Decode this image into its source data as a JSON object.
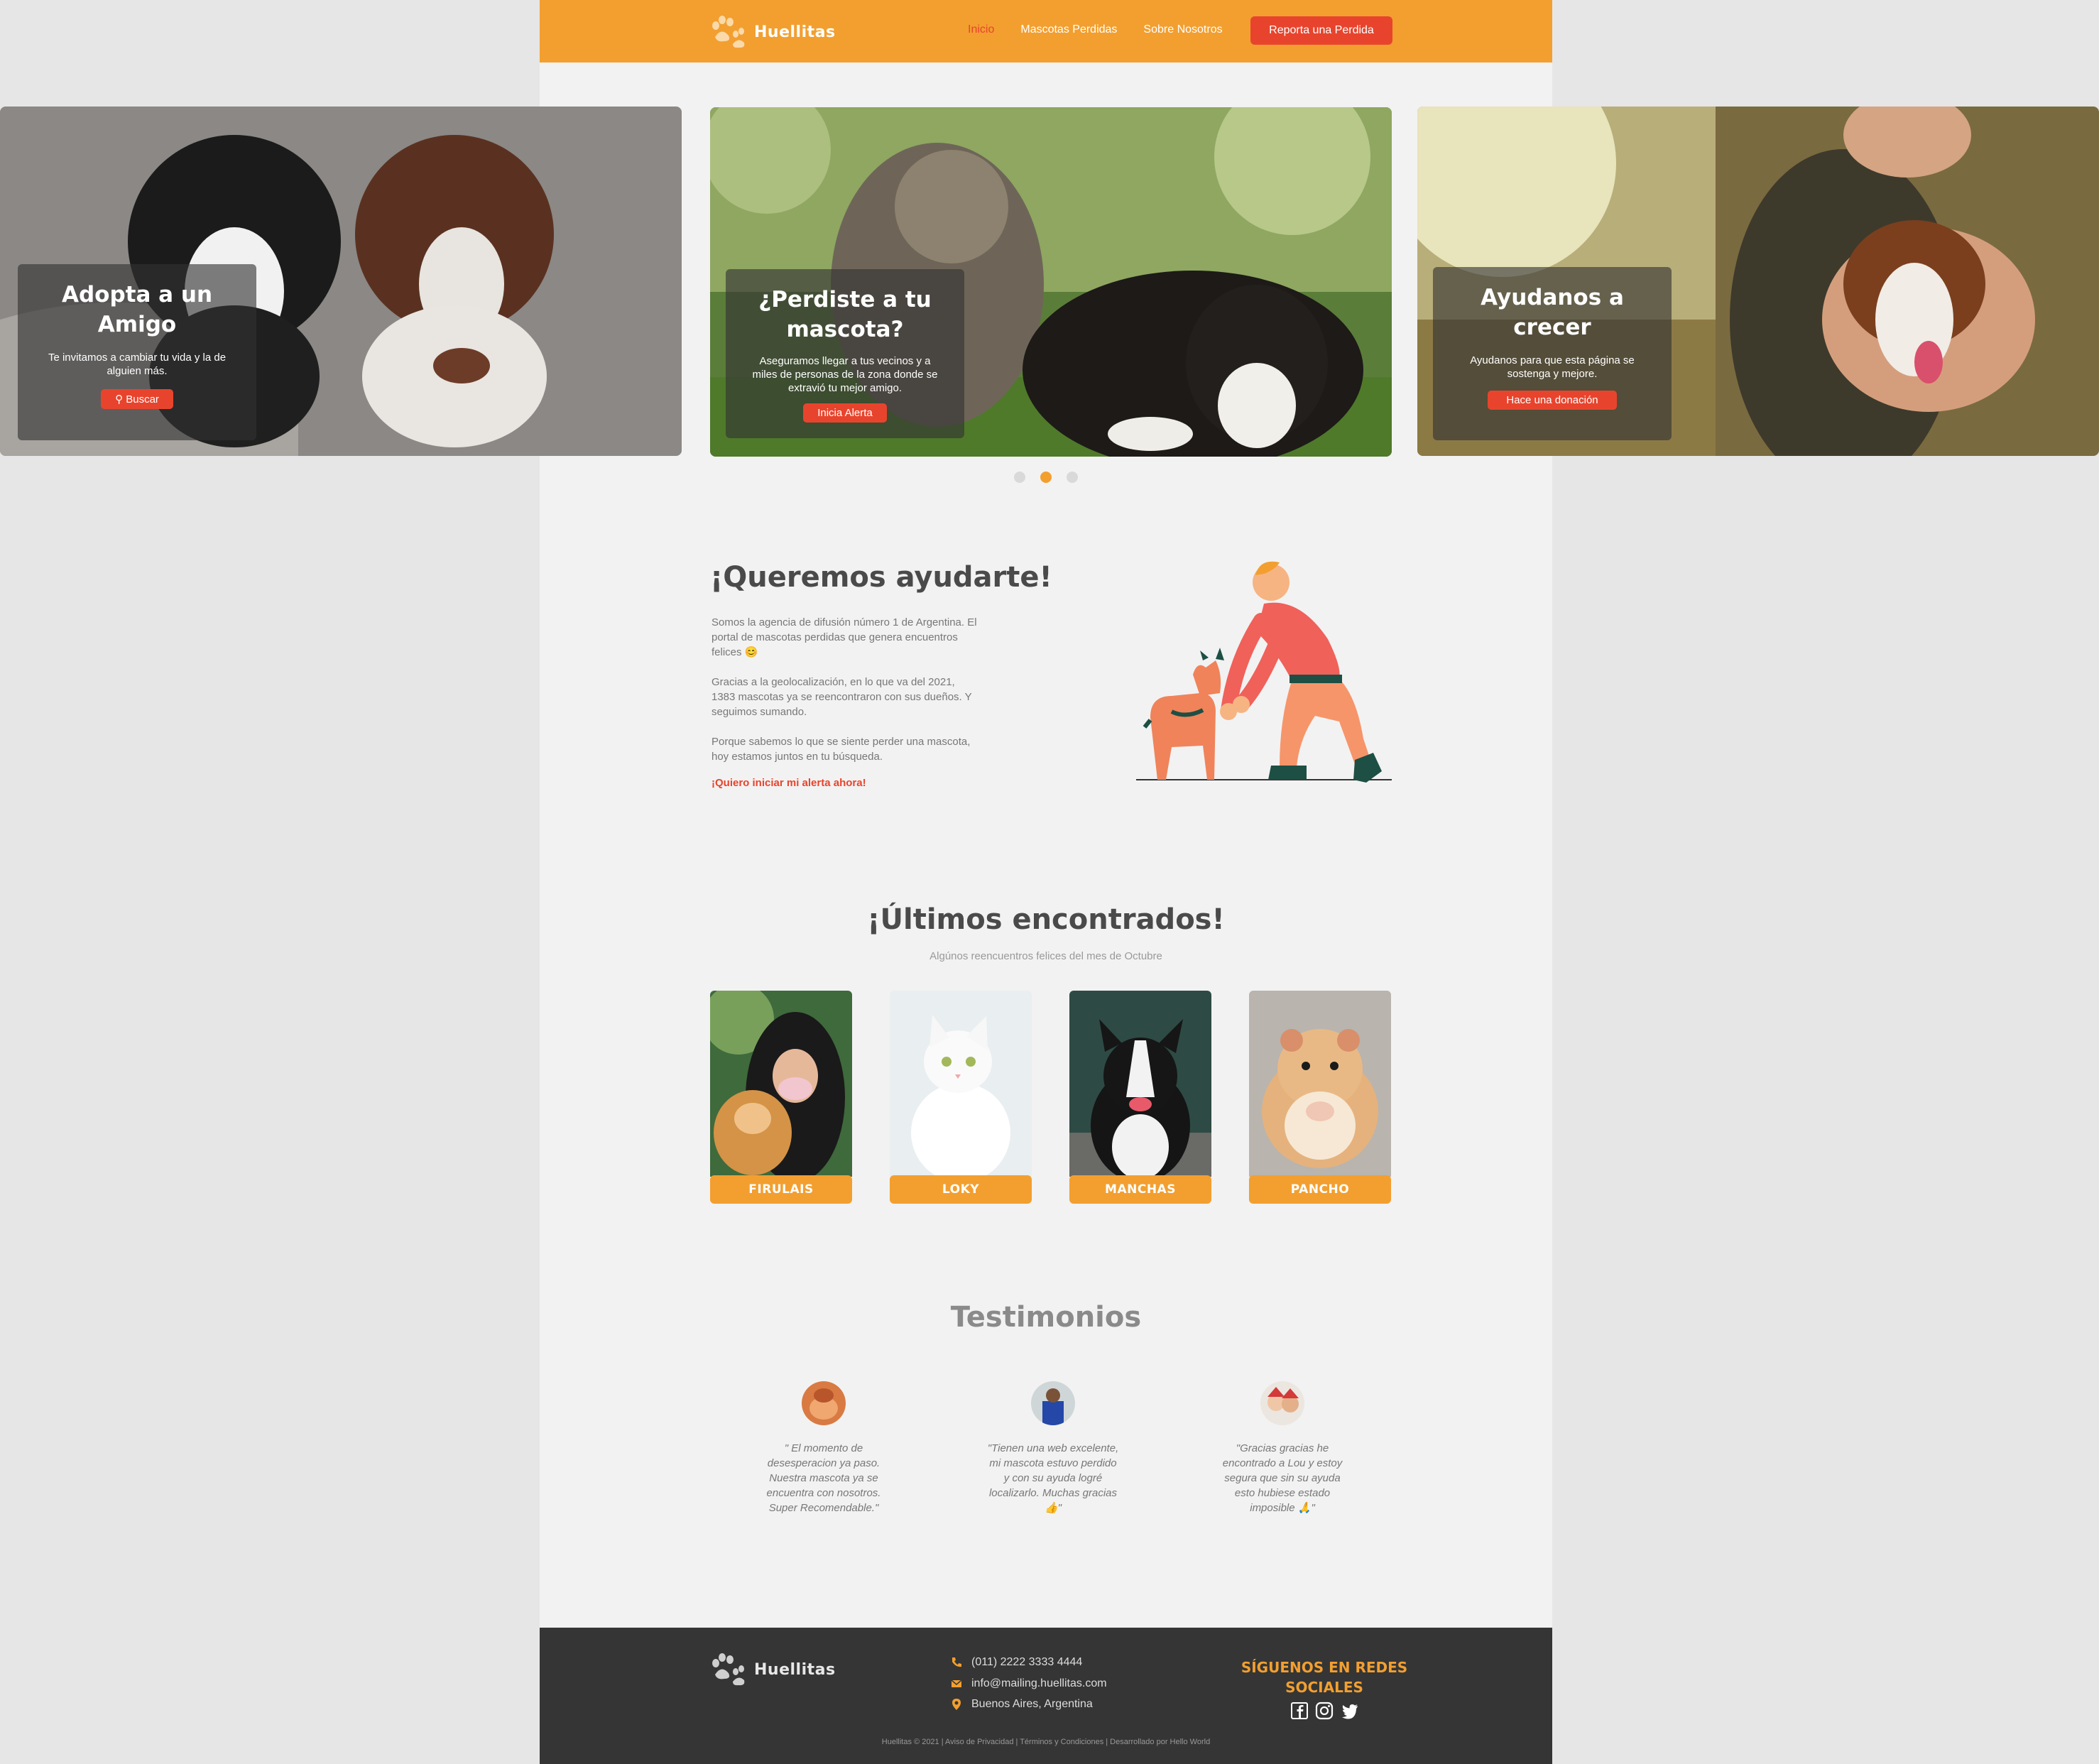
{
  "brand": {
    "name": "Huellitas",
    "accent": "#f29f30",
    "cta_color": "#e8442d",
    "footer_bg": "#353535"
  },
  "nav": {
    "links": [
      {
        "label": "Inicio",
        "active": true
      },
      {
        "label": "Mascotas Perdidas",
        "active": false
      },
      {
        "label": "Sobre Nosotros",
        "active": false
      }
    ],
    "cta": "Reporta una Perdida"
  },
  "carousel": {
    "slides": [
      {
        "title": "Adopta a un Amigo",
        "text": "Te invitamos a cambiar tu vida y la de alguien más.",
        "button": "Buscar",
        "button_icon": "search-icon"
      },
      {
        "title": "¿Perdiste a tu mascota?",
        "text": "Aseguramos llegar a tus vecinos y a miles de personas de la zona donde se extravió tu mejor amigo.",
        "button": "Inicia Alerta"
      },
      {
        "title": "Ayudanos a crecer",
        "text": "Ayudanos para que esta página se sostenga y mejore.",
        "button": "Hace una donación"
      }
    ],
    "active_index": 1,
    "dot_count": 3
  },
  "help": {
    "title": "¡Queremos ayudarte!",
    "paragraphs": [
      "Somos la agencia de difusión número 1 de Argentina. El portal de mascotas perdidas que genera encuentros felices 😊",
      "Gracias a la geolocalización, en lo que va del 2021, 1383 mascotas ya se reencontraron con sus dueños. Y seguimos sumando.",
      "Porque sabemos lo que se siente perder una mascota, hoy estamos juntos en tu búsqueda."
    ],
    "link": "¡Quiero iniciar mi alerta ahora!"
  },
  "found": {
    "title": "¡Últimos encontrados!",
    "subtitle": "Algúnos reencuentros felices del mes de Octubre",
    "pets": [
      {
        "name": "FIRULAIS"
      },
      {
        "name": "LOKY"
      },
      {
        "name": "MANCHAS"
      },
      {
        "name": "PANCHO"
      }
    ]
  },
  "testimonials": {
    "title": "Testimonios",
    "items": [
      {
        "quote": "\" El momento de desesperacion ya paso. Nuestra mascota ya se encuentra con nosotros. Super Recomendable.\""
      },
      {
        "quote": "\"Tienen una web excelente, mi mascota estuvo perdido y con su ayuda logré localizarlo. Muchas gracias 👍\""
      },
      {
        "quote": "\"Gracias gracias he encontrado a Lou y estoy segura que sin su ayuda esto hubiese estado imposible 🙏\""
      }
    ]
  },
  "footer": {
    "phone": "(011) 2222 3333 4444",
    "email": "info@mailing.huellitas.com",
    "address": "Buenos Aires, Argentina",
    "follow": "SÍGUENOS EN REDES SOCIALES",
    "social": [
      "facebook-icon",
      "instagram-icon",
      "twitter-icon"
    ],
    "legal": "Huellitas © 2021 | Aviso de Privacidad | Términos y Condiciones | Desarrollado por Hello World"
  }
}
